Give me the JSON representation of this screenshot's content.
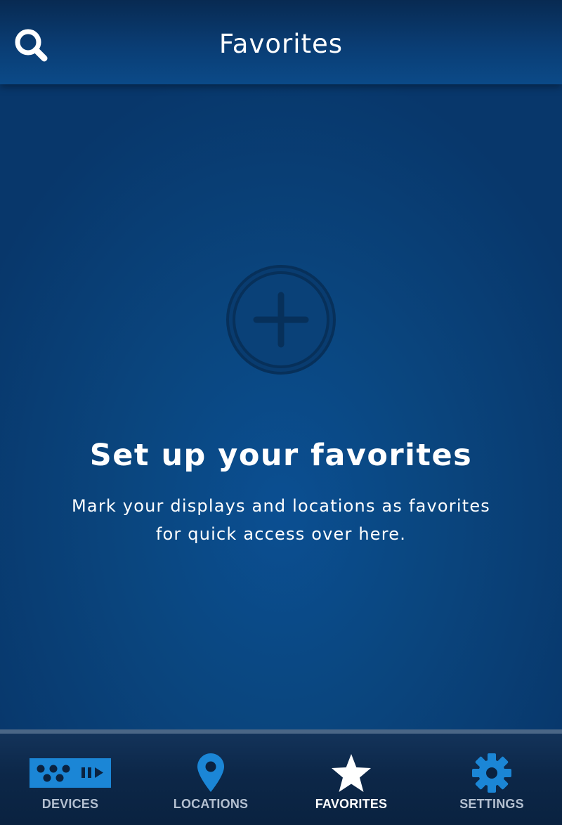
{
  "header": {
    "title": "Favorites",
    "search_icon": "search-icon"
  },
  "empty_state": {
    "add_icon": "plus-circle-icon",
    "headline": "Set up your favorites",
    "description": "Mark your displays and locations as favorites for quick access over here."
  },
  "tabs": [
    {
      "label": "DEVICES",
      "icon": "devices-icon",
      "active": false
    },
    {
      "label": "LOCATIONS",
      "icon": "location-pin-icon",
      "active": false
    },
    {
      "label": "FAVORITES",
      "icon": "star-icon",
      "active": true
    },
    {
      "label": "SETTINGS",
      "icon": "gear-icon",
      "active": false
    }
  ],
  "colors": {
    "accent": "#1b86d6",
    "active_tab": "#ffffff",
    "inactive_tab_label": "#b4c0d0",
    "background": "#0a4a88"
  }
}
